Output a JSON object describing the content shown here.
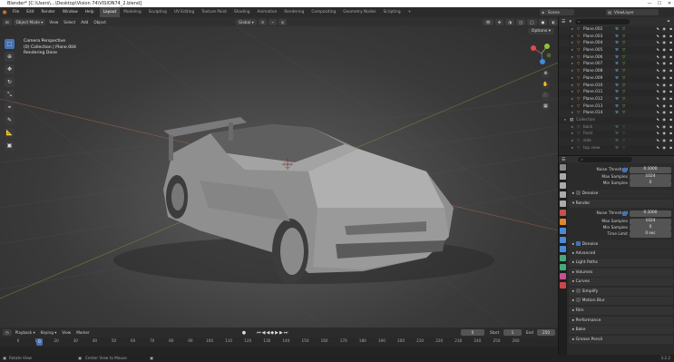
{
  "window": {
    "title": "Blender* [C:\\Users\\...\\Desktop\\Vision 74\\VISION74_2.blend]",
    "buttons": [
      "—",
      "☐",
      "✕"
    ]
  },
  "topmenu": {
    "items": [
      "File",
      "Edit",
      "Render",
      "Window",
      "Help"
    ],
    "workspaces": [
      "Layout",
      "Modeling",
      "Sculpting",
      "UV Editing",
      "Texture Paint",
      "Shading",
      "Animation",
      "Rendering",
      "Compositing",
      "Geometry Nodes",
      "Scripting",
      "+"
    ],
    "active_workspace": "Layout",
    "scene_label": "Scene",
    "view_layer_label": "ViewLayer"
  },
  "viewport_header": {
    "mode": "Object Mode",
    "menus": [
      "View",
      "Select",
      "Add",
      "Object"
    ],
    "orientation": "Global",
    "options_label": "Options"
  },
  "viewport_info": {
    "line1": "Camera Perspective",
    "line2": "(0) Collection | Plane.004",
    "line3": "Rendering Done"
  },
  "tools": [
    "select",
    "cursor",
    "move",
    "rotate",
    "scale",
    "transform",
    "annotate",
    "measure",
    "add-cube"
  ],
  "outliner": {
    "rows": [
      {
        "name": "Plane.002",
        "dim": false
      },
      {
        "name": "Plane.003",
        "dim": false
      },
      {
        "name": "Plane.004",
        "dim": false
      },
      {
        "name": "Plane.005",
        "dim": false
      },
      {
        "name": "Plane.006",
        "dim": false
      },
      {
        "name": "Plane.007",
        "dim": false
      },
      {
        "name": "Plane.008",
        "dim": false
      },
      {
        "name": "Plane.009",
        "dim": false
      },
      {
        "name": "Plane.010",
        "dim": false
      },
      {
        "name": "Plane.011",
        "dim": false
      },
      {
        "name": "Plane.012",
        "dim": false
      },
      {
        "name": "Plane.013",
        "dim": false
      },
      {
        "name": "Plane.014",
        "dim": false
      },
      {
        "name": "Collection",
        "dim": true
      },
      {
        "name": "back",
        "dim": true
      },
      {
        "name": "front",
        "dim": true
      },
      {
        "name": "side",
        "dim": true
      },
      {
        "name": "top view",
        "dim": true
      }
    ]
  },
  "properties": {
    "noise_threshold_label": "Noise Threshold",
    "noise_threshold_value": "0.1000",
    "max_samples_label": "Max Samples",
    "max_samples_value": "1024",
    "min_samples_label": "Min Samples",
    "min_samples_value": "0",
    "denoise_label": "Denoise",
    "render_label": "Render",
    "r_noise_threshold_label": "Noise Threshold",
    "r_noise_threshold_value": "0.1000",
    "r_max_samples_label": "Max Samples",
    "r_max_samples_value": "1024",
    "r_min_samples_label": "Min Samples",
    "r_min_samples_value": "0",
    "time_limit_label": "Time Limit",
    "time_limit_value": "0 sec",
    "r_denoise_label": "Denoise",
    "advanced_label": "Advanced",
    "panels": [
      "Light Paths",
      "Volumes",
      "Curves",
      "Simplify",
      "Motion Blur",
      "Film",
      "Performance",
      "Bake",
      "Grease Pencil"
    ]
  },
  "timeline": {
    "menus": [
      "Playback",
      "Keying",
      "View",
      "Marker"
    ],
    "current_frame": "0",
    "start_label": "Start",
    "start_value": "1",
    "end_label": "End",
    "end_value": "250",
    "frame_box": "0",
    "ticks": [
      "0",
      "10",
      "20",
      "30",
      "40",
      "50",
      "60",
      "70",
      "80",
      "90",
      "100",
      "110",
      "120",
      "130",
      "140",
      "150",
      "160",
      "170",
      "180",
      "190",
      "200",
      "210",
      "220",
      "230",
      "240",
      "250",
      "260"
    ]
  },
  "statusbar": {
    "left": "Rotate View",
    "mid": "Center View to Mouse",
    "version": "3.2.2"
  },
  "colors": {
    "accent": "#4772b3",
    "axis_x": "#e04b4b",
    "axis_y": "#8fc33a",
    "axis_z": "#3f8be0",
    "object_orange": "#e0872e"
  }
}
